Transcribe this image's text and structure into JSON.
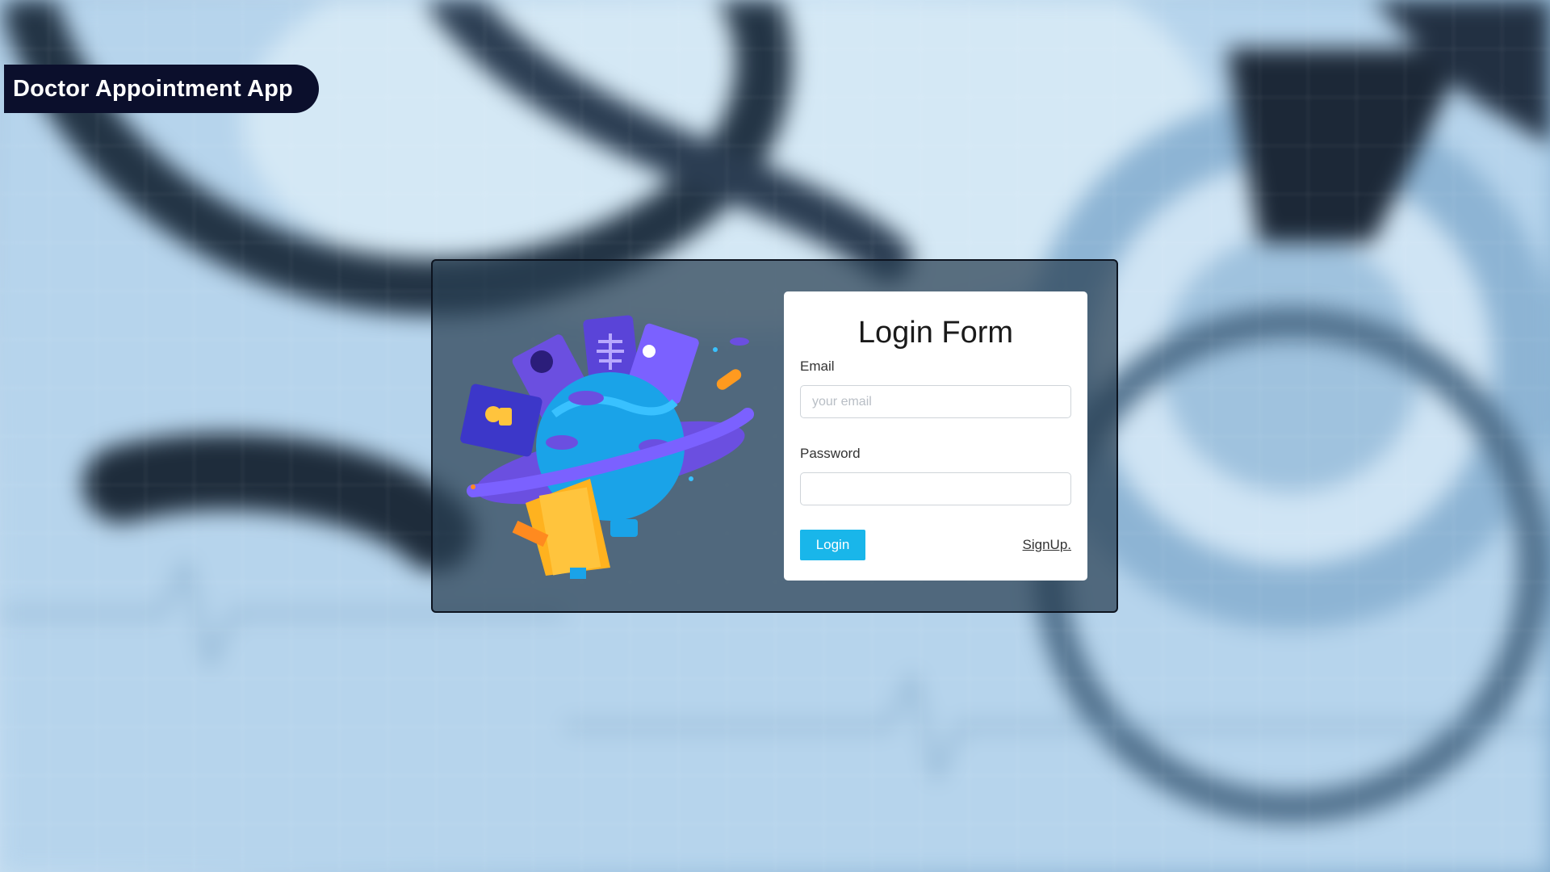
{
  "app": {
    "title": "Doctor Appointment App"
  },
  "login": {
    "title": "Login Form",
    "email_label": "Email",
    "email_placeholder": "your email",
    "email_value": "",
    "password_label": "Password",
    "password_value": "",
    "login_button": "Login",
    "signup_link": "SignUp."
  },
  "colors": {
    "brand_bg": "#0b0f2c",
    "accent": "#19b6ea",
    "card_overlay": "#283e52"
  },
  "icons": [
    "medical-planet-illustration",
    "stethoscope-background"
  ]
}
